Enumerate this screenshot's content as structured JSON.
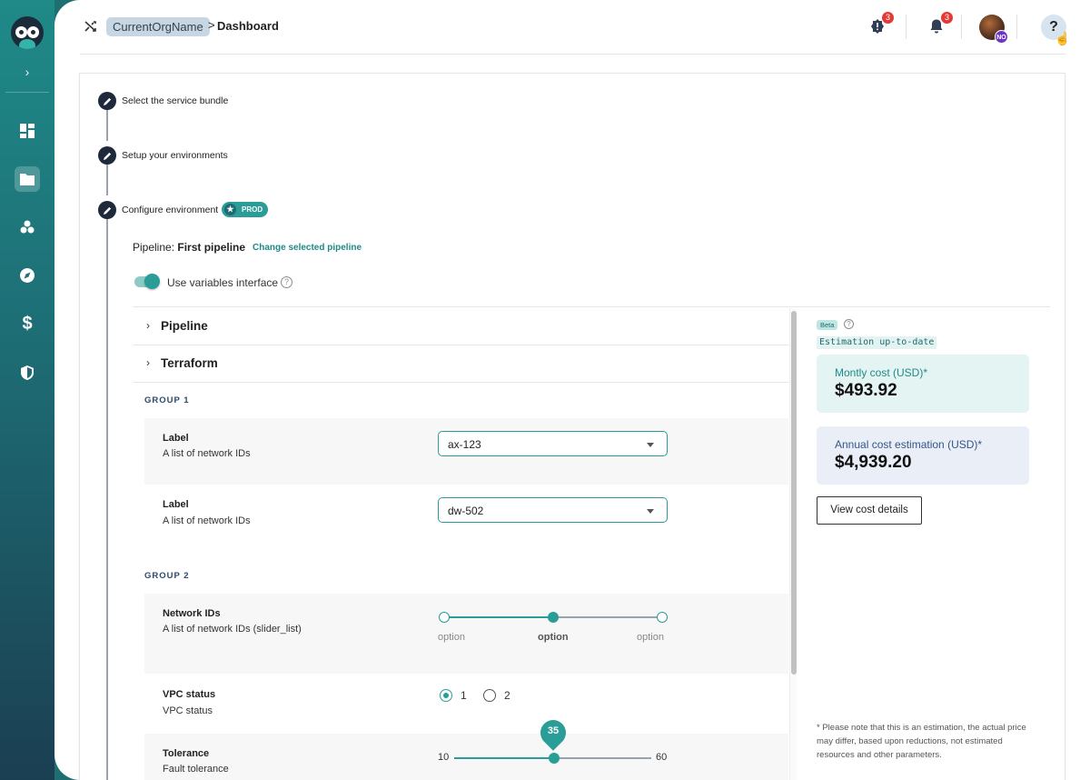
{
  "header": {
    "org_name": "CurrentOrgName",
    "separator": ">",
    "page": "Dashboard",
    "alerts_count": "3",
    "notifications_count": "3",
    "avatar_initials": "NO",
    "help": "?"
  },
  "steps": [
    {
      "label": "Select the service bundle"
    },
    {
      "label": "Setup your environments"
    },
    {
      "label": "Configure environment",
      "tag": "PROD"
    }
  ],
  "pipeline": {
    "prefix": "Pipeline:",
    "name": "First pipeline",
    "change_link": "Change selected pipeline"
  },
  "variables_toggle": {
    "label": "Use variables interface",
    "on": true
  },
  "accordions": [
    {
      "title": "Pipeline"
    },
    {
      "title": "Terraform"
    }
  ],
  "groups": [
    {
      "title": "GROUP 1",
      "rows": [
        {
          "label": "Label",
          "desc": "A list of network IDs",
          "value": "ax-123"
        },
        {
          "label": "Label",
          "desc": "A list of network IDs",
          "value": "dw-502"
        }
      ]
    },
    {
      "title": "GROUP 2",
      "slider_row": {
        "label": "Network IDs",
        "desc": "A list of network IDs (slider_list)",
        "options": [
          "option",
          "option",
          "option"
        ],
        "selected_index": 1
      },
      "radio_row": {
        "label": "VPC status",
        "desc": "VPC status",
        "options": [
          "1",
          "2"
        ],
        "selected": "1"
      },
      "tolerance_row": {
        "label": "Tolerance",
        "desc": "Fault tolerance",
        "min": "10",
        "max": "60",
        "value": "35"
      }
    }
  ],
  "cost": {
    "beta": "Beta",
    "status": "Estimation up-to-date",
    "monthly_label": "Montly cost (USD)*",
    "monthly_value": "$493.92",
    "annual_label": "Annual cost estimation (USD)*",
    "annual_value": "$4,939.20",
    "details_button": "View cost details",
    "footnote": "* Please note that this is an estimation, the actual price may differ, based upon reductions, not estimated resources and other parameters."
  },
  "colors": {
    "accent": "#2a9d98",
    "sidebar_top": "#1f8a88",
    "sidebar_bottom": "#1b3f52",
    "badge": "#e53935"
  },
  "icons": {
    "sidebar": [
      "dashboard-icon",
      "folder-icon",
      "cubes-icon",
      "compass-icon",
      "dollar-icon",
      "shield-icon"
    ],
    "header": [
      "shuffle-icon",
      "alert-badge-icon",
      "bell-icon",
      "help-icon"
    ]
  }
}
